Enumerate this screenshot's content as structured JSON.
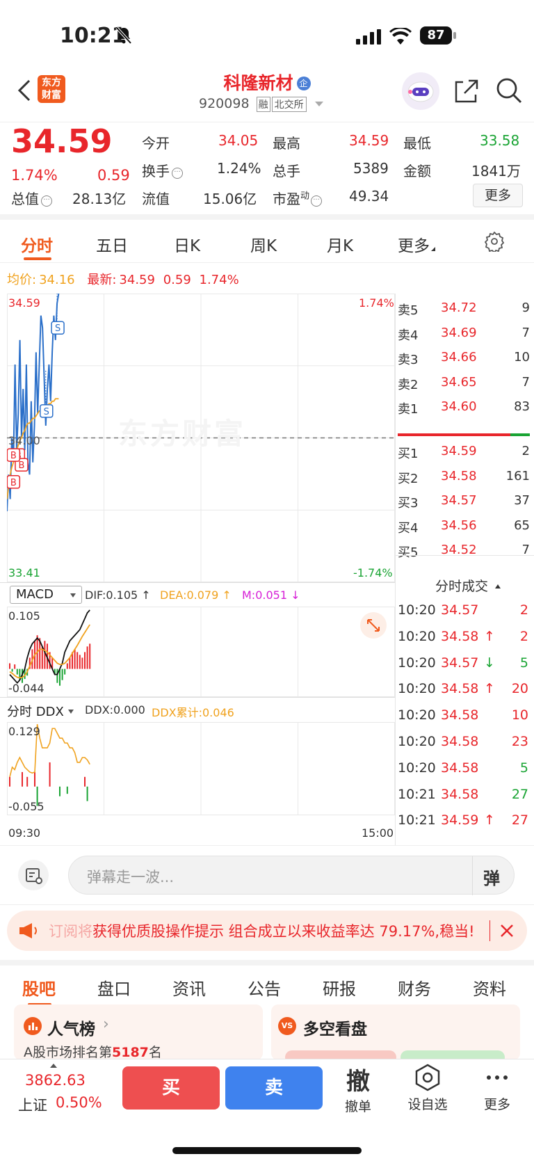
{
  "status_bar": {
    "time": "10:21",
    "battery": "87"
  },
  "header": {
    "stock_name": "科隆新材",
    "badge": "企",
    "code": "920098",
    "tag1": "融",
    "tag2": "北交所",
    "logo_line1": "东方",
    "logo_line2": "财富"
  },
  "quote": {
    "price": "34.59",
    "change_pct": "1.74%",
    "change": "0.59",
    "open_label": "今开",
    "open": "34.05",
    "high_label": "最高",
    "high": "34.59",
    "low_label": "最低",
    "low": "33.58",
    "turnover_label": "换手",
    "turnover": "1.24%",
    "volume_label": "总手",
    "volume": "5389",
    "amount_label": "金额",
    "amount": "1841万",
    "mcap_label": "总值",
    "mcap": "28.13亿",
    "float_label": "流值",
    "float_mcap": "15.06亿",
    "pe_label": "市盈",
    "pe_sup": "动",
    "pe": "49.34",
    "more_btn": "更多"
  },
  "tabs": [
    "分时",
    "五日",
    "日K",
    "周K",
    "月K",
    "更多"
  ],
  "chart_info": {
    "avg_label": "均价:",
    "avg": "34.16",
    "last_label": "最新:",
    "last": "34.59",
    "last_chg": "0.59",
    "last_pct": "1.74%"
  },
  "chart_data": [
    {
      "type": "line",
      "title": "",
      "y_max_label": "34.59",
      "y_min_label": "33.41",
      "pct_max_label": "1.74%",
      "pct_min_label": "-1.74%",
      "ref_label": "34.00",
      "xlabel_start": "09:30",
      "xlabel_end": "15:00",
      "ylim": [
        33.41,
        34.59
      ],
      "ref": 34.0,
      "x_count": 240,
      "watermark": "东方财富",
      "series": [
        {
          "values": [
            33.7,
            33.85,
            33.75,
            34.0,
            33.9,
            34.3,
            33.95,
            34.1,
            34.4,
            34.0,
            34.2,
            33.95,
            34.3,
            33.9,
            33.85,
            34.15,
            33.9,
            34.05,
            34.35,
            34.1,
            34.3,
            34.5,
            34.45,
            34.25,
            34.05,
            34.2,
            34.3,
            34.15,
            34.35,
            34.5,
            34.4,
            34.55,
            34.59
          ]
        },
        {
          "values": [
            33.75,
            33.8,
            33.85,
            33.88,
            33.9,
            33.93,
            33.95,
            33.97,
            33.99,
            34.0,
            34.02,
            34.03,
            34.05,
            34.06,
            34.06,
            34.07,
            34.08,
            34.08,
            34.09,
            34.1,
            34.11,
            34.11,
            34.12,
            34.12,
            34.13,
            34.13,
            34.14,
            34.14,
            34.15,
            34.15,
            34.16,
            34.16,
            34.16
          ]
        }
      ],
      "markers": [
        {
          "label": "S",
          "x": 31,
          "price": 34.45
        },
        {
          "label": "S",
          "x": 24,
          "price": 34.11
        },
        {
          "label": "B",
          "x": 4,
          "price": 33.93
        },
        {
          "label": "B",
          "x": 6,
          "price": 33.89
        },
        {
          "label": "B",
          "x": 1,
          "price": 33.93
        },
        {
          "label": "B",
          "x": 1,
          "price": 33.82
        }
      ]
    },
    {
      "type": "bar",
      "title": "",
      "indicator": "MACD",
      "dif_label": "DIF:0.105",
      "dea_label": "DEA:0.079",
      "m_label": "M:0.051",
      "y_max_label": "0.105",
      "y_min_label": "-0.044",
      "ylim": [
        -0.044,
        0.105
      ],
      "x_count": 240,
      "hist": [
        0.01,
        -0.005,
        0.008,
        -0.01,
        -0.02,
        -0.025,
        -0.018,
        -0.012,
        0.02,
        0.035,
        0.05,
        0.06,
        0.055,
        0.04,
        0.05,
        0.045,
        0.03,
        0.02,
        -0.01,
        -0.025,
        -0.03,
        -0.02,
        -0.01,
        0.01,
        0.02,
        0.03,
        0.035,
        0.03,
        0.025,
        0.02,
        0.03,
        0.04,
        0.045
      ],
      "dif": [
        -0.01,
        -0.015,
        -0.02,
        -0.025,
        -0.02,
        -0.01,
        0.0,
        0.02,
        0.035,
        0.045,
        0.05,
        0.055,
        0.05,
        0.04,
        0.03,
        0.02,
        0.01,
        0.0,
        -0.01,
        -0.01,
        0.0,
        0.01,
        0.03,
        0.04,
        0.05,
        0.055,
        0.06,
        0.065,
        0.07,
        0.08,
        0.09,
        0.1,
        0.105
      ],
      "dea": [
        -0.005,
        -0.008,
        -0.012,
        -0.015,
        -0.016,
        -0.015,
        -0.012,
        -0.005,
        0.005,
        0.015,
        0.025,
        0.03,
        0.035,
        0.035,
        0.033,
        0.03,
        0.025,
        0.02,
        0.015,
        0.01,
        0.008,
        0.008,
        0.01,
        0.015,
        0.02,
        0.028,
        0.035,
        0.042,
        0.05,
        0.058,
        0.065,
        0.072,
        0.079
      ]
    },
    {
      "type": "bar",
      "title": "",
      "indicator": "分时 DDX",
      "ddx_label": "DDX:0.000",
      "ddx_sum_label": "DDX累计:0.046",
      "y_max_label": "0.129",
      "y_min_label": "-0.055",
      "ylim": [
        -0.055,
        0.129
      ],
      "x_count": 240,
      "line": [
        0.02,
        0.04,
        0.035,
        0.05,
        0.06,
        0.05,
        0.04,
        0.035,
        0.03,
        0.028,
        0.03,
        0.129,
        0.1,
        0.08,
        0.08,
        0.08,
        0.09,
        0.12,
        0.12,
        0.11,
        0.1,
        0.1,
        0.09,
        0.09,
        0.08,
        0.08,
        0.07,
        0.05,
        0.05,
        0.06,
        0.06,
        0.055,
        0.046
      ],
      "bars": [
        0.02,
        0,
        0,
        0,
        0,
        0.03,
        0,
        0.02,
        0,
        0,
        0.03,
        -0.04,
        0,
        0.0,
        0,
        0,
        0.05,
        0,
        0,
        0,
        -0.02,
        0,
        0,
        -0.015,
        0,
        0,
        0,
        0,
        0,
        0,
        0.02,
        -0.03,
        0
      ]
    }
  ],
  "orderbook": {
    "asks": [
      {
        "label": "卖5",
        "price": "34.72",
        "vol": "9"
      },
      {
        "label": "卖4",
        "price": "34.69",
        "vol": "7"
      },
      {
        "label": "卖3",
        "price": "34.66",
        "vol": "10"
      },
      {
        "label": "卖2",
        "price": "34.65",
        "vol": "7"
      },
      {
        "label": "卖1",
        "price": "34.60",
        "vol": "83"
      }
    ],
    "bids": [
      {
        "label": "买1",
        "price": "34.59",
        "vol": "2"
      },
      {
        "label": "买2",
        "price": "34.58",
        "vol": "161"
      },
      {
        "label": "买3",
        "price": "34.57",
        "vol": "37"
      },
      {
        "label": "买4",
        "price": "34.56",
        "vol": "65"
      },
      {
        "label": "买5",
        "price": "34.52",
        "vol": "7"
      }
    ],
    "ask_ratio": 0.85
  },
  "trades": {
    "header": "分时成交",
    "rows": [
      {
        "time": "10:20",
        "price": "34.57",
        "arrow": "",
        "vol": "2",
        "dir": "up"
      },
      {
        "time": "10:20",
        "price": "34.58",
        "arrow": "↑",
        "vol": "2",
        "dir": "up"
      },
      {
        "time": "10:20",
        "price": "34.57",
        "arrow": "↓",
        "vol": "5",
        "dir": "down"
      },
      {
        "time": "10:20",
        "price": "34.58",
        "arrow": "↑",
        "vol": "20",
        "dir": "up"
      },
      {
        "time": "10:20",
        "price": "34.58",
        "arrow": "",
        "vol": "10",
        "dir": "up"
      },
      {
        "time": "10:20",
        "price": "34.58",
        "arrow": "",
        "vol": "23",
        "dir": "up"
      },
      {
        "time": "10:20",
        "price": "34.58",
        "arrow": "",
        "vol": "5",
        "dir": "down"
      },
      {
        "time": "10:21",
        "price": "34.58",
        "arrow": "",
        "vol": "27",
        "dir": "down"
      },
      {
        "time": "10:21",
        "price": "34.59",
        "arrow": "↑",
        "vol": "27",
        "dir": "up"
      }
    ]
  },
  "danmu": {
    "placeholder": "弹幕走一波...",
    "toggle": "弹"
  },
  "promo": {
    "text": "获得优质股操作提示 组合成立以来收益率达 79.17%,稳当!",
    "prefix": "订阅将"
  },
  "bottom_tabs": [
    "股吧",
    "盘口",
    "资讯",
    "公告",
    "研报",
    "财务",
    "资料"
  ],
  "cards": {
    "left_title": "人气榜",
    "left_sub_prefix": "A股市场排名第",
    "left_rank": "5187",
    "left_sub_suffix": "名",
    "right_title": "多空看盘"
  },
  "bottom_bar": {
    "index_value": "3862.63",
    "index_name": "上证",
    "index_pct": "0.50%",
    "buy": "买",
    "sell": "卖",
    "cancel_icon": "撤",
    "cancel": "撤单",
    "watch": "设自选",
    "more": "更多"
  },
  "colors": {
    "up": "#e8262b",
    "down": "#1aa434",
    "price_line": "#2a6fc9",
    "avg_line": "#f0a21e",
    "accent": "#f05a1e"
  }
}
